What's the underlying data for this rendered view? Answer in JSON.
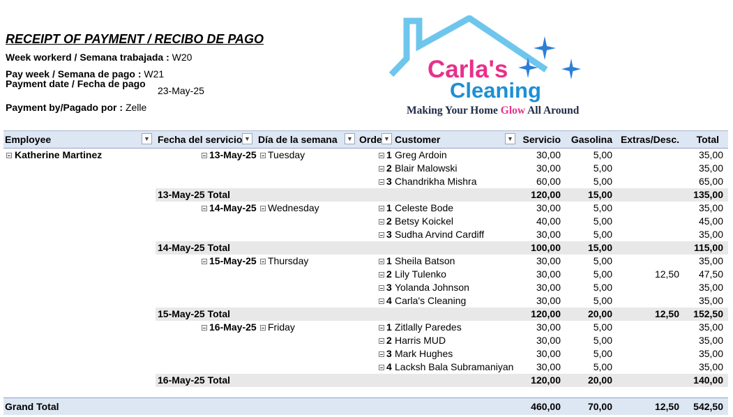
{
  "receipt": {
    "title": "RECEIPT OF PAYMENT / RECIBO DE PAGO",
    "week_worked_label": "Week workerd / Semana trabajada :",
    "week_worked_value": "W20",
    "pay_week_label": "Pay week / Semana de pago :",
    "pay_week_value": "W21",
    "payment_date_label": "Payment date / Fecha de pago",
    "payment_date_value": "23-May-25",
    "payment_by_label": "Payment by/Pagado por :",
    "payment_by_value": "Zelle"
  },
  "logo": {
    "name_line1": "Carla's",
    "name_line2": "Cleaning",
    "tagline_a": "Making Your Home ",
    "tagline_glow": "Glow",
    "tagline_b": " All Around",
    "colors": {
      "pink": "#e8308a",
      "blue": "#1d8fd6",
      "roof": "#6ec6ec",
      "star": "#2b7fd8"
    }
  },
  "table": {
    "headers": {
      "employee": "Employee",
      "fecha": "Fecha del servicio",
      "dia": "Día de la semana",
      "order": "Orde",
      "customer": "Customer",
      "servicio": "Servicio",
      "gasolina": "Gasolina",
      "extras": "Extras/Desc.",
      "total": "Total"
    },
    "employee": "Katherine Martinez",
    "days": [
      {
        "date": "13-May-25",
        "weekday": "Tuesday",
        "rows": [
          {
            "order": "1",
            "customer": "Greg Ardoin",
            "servicio": "30,00",
            "gasolina": "5,00",
            "extras": "",
            "total": "35,00"
          },
          {
            "order": "2",
            "customer": "Blair Malowski",
            "servicio": "30,00",
            "gasolina": "5,00",
            "extras": "",
            "total": "35,00"
          },
          {
            "order": "3",
            "customer": "Chandrikha Mishra",
            "servicio": "60,00",
            "gasolina": "5,00",
            "extras": "",
            "total": "65,00"
          }
        ],
        "subtotal": {
          "label": "13-May-25 Total",
          "servicio": "120,00",
          "gasolina": "15,00",
          "extras": "",
          "total": "135,00"
        }
      },
      {
        "date": "14-May-25",
        "weekday": "Wednesday",
        "rows": [
          {
            "order": "1",
            "customer": "Celeste Bode",
            "servicio": "30,00",
            "gasolina": "5,00",
            "extras": "",
            "total": "35,00"
          },
          {
            "order": "2",
            "customer": "Betsy Koickel",
            "servicio": "40,00",
            "gasolina": "5,00",
            "extras": "",
            "total": "45,00"
          },
          {
            "order": "3",
            "customer": "Sudha Arvind Cardiff",
            "servicio": "30,00",
            "gasolina": "5,00",
            "extras": "",
            "total": "35,00"
          }
        ],
        "subtotal": {
          "label": "14-May-25 Total",
          "servicio": "100,00",
          "gasolina": "15,00",
          "extras": "",
          "total": "115,00"
        }
      },
      {
        "date": "15-May-25",
        "weekday": "Thursday",
        "rows": [
          {
            "order": "1",
            "customer": "Sheila Batson",
            "servicio": "30,00",
            "gasolina": "5,00",
            "extras": "",
            "total": "35,00"
          },
          {
            "order": "2",
            "customer": "Lily Tulenko",
            "servicio": "30,00",
            "gasolina": "5,00",
            "extras": "12,50",
            "total": "47,50"
          },
          {
            "order": "3",
            "customer": "Yolanda Johnson",
            "servicio": "30,00",
            "gasolina": "5,00",
            "extras": "",
            "total": "35,00"
          },
          {
            "order": "4",
            "customer": "Carla's Cleaning",
            "servicio": "30,00",
            "gasolina": "5,00",
            "extras": "",
            "total": "35,00"
          }
        ],
        "subtotal": {
          "label": "15-May-25 Total",
          "servicio": "120,00",
          "gasolina": "20,00",
          "extras": "12,50",
          "total": "152,50"
        }
      },
      {
        "date": "16-May-25",
        "weekday": "Friday",
        "rows": [
          {
            "order": "1",
            "customer": "Zitlally Paredes",
            "servicio": "30,00",
            "gasolina": "5,00",
            "extras": "",
            "total": "35,00"
          },
          {
            "order": "2",
            "customer": "Harris MUD",
            "servicio": "30,00",
            "gasolina": "5,00",
            "extras": "",
            "total": "35,00"
          },
          {
            "order": "3",
            "customer": "Mark Hughes",
            "servicio": "30,00",
            "gasolina": "5,00",
            "extras": "",
            "total": "35,00"
          },
          {
            "order": "4",
            "customer": "Lacksh Bala Subramaniyan",
            "servicio": "30,00",
            "gasolina": "5,00",
            "extras": "",
            "total": "35,00"
          }
        ],
        "subtotal": {
          "label": "16-May-25 Total",
          "servicio": "120,00",
          "gasolina": "20,00",
          "extras": "",
          "total": "140,00"
        }
      }
    ],
    "grand_total": {
      "label": "Grand Total",
      "servicio": "460,00",
      "gasolina": "70,00",
      "extras": "12,50",
      "total": "542,50"
    }
  }
}
